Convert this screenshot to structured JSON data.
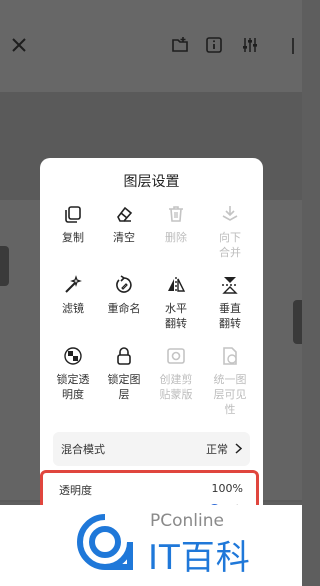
{
  "toolbar": {
    "icons": [
      "close-icon",
      "folder-add-icon",
      "info-icon",
      "adjust-sliders-icon",
      "more-icon"
    ]
  },
  "sheet": {
    "title": "图层设置",
    "items": [
      {
        "label": "复制",
        "icon": "copy-icon",
        "enabled": true
      },
      {
        "label": "清空",
        "icon": "eraser-icon",
        "enabled": true
      },
      {
        "label": "删除",
        "icon": "trash-icon",
        "enabled": false
      },
      {
        "label": "向下合并",
        "icon": "merge-down-icon",
        "enabled": false
      },
      {
        "label": "滤镜",
        "icon": "magic-wand-icon",
        "enabled": true
      },
      {
        "label": "重命名",
        "icon": "rename-icon",
        "enabled": true
      },
      {
        "label": "水平翻转",
        "icon": "flip-horizontal-icon",
        "enabled": true
      },
      {
        "label": "垂直翻转",
        "icon": "flip-vertical-icon",
        "enabled": true
      },
      {
        "label": "锁定透明度",
        "icon": "lock-transparency-icon",
        "enabled": true
      },
      {
        "label": "锁定图层",
        "icon": "lock-icon",
        "enabled": true
      },
      {
        "label": "创建剪贴蒙版",
        "icon": "clipping-mask-icon",
        "enabled": false
      },
      {
        "label": "统一图层可见性",
        "icon": "visibility-icon",
        "enabled": false
      }
    ],
    "blend_mode": {
      "label": "混合模式",
      "value": "正常"
    },
    "opacity": {
      "label": "透明度",
      "value_text": "100%",
      "value": 1.0,
      "minus": "−",
      "plus": "+"
    }
  },
  "watermark": {
    "brand": "PConline",
    "title": "IT百科"
  },
  "colors": {
    "accent": "#2f6bd8",
    "highlight": "#e0463e",
    "watermark_blue": "#1f78d9"
  }
}
